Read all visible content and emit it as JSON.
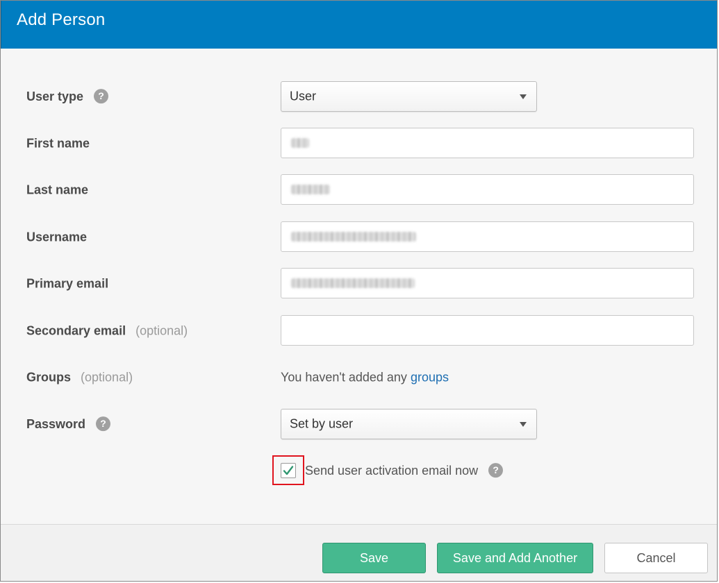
{
  "dialog": {
    "title": "Add Person"
  },
  "form": {
    "user_type": {
      "label": "User type",
      "value": "User",
      "help_icon": "question-circle-icon"
    },
    "first_name": {
      "label": "First name",
      "value_redacted": true
    },
    "last_name": {
      "label": "Last name",
      "value_redacted": true
    },
    "username": {
      "label": "Username",
      "value_redacted": true
    },
    "primary_email": {
      "label": "Primary email",
      "value_redacted": true
    },
    "secondary_email": {
      "label": "Secondary email",
      "optional": "(optional)",
      "value": ""
    },
    "groups": {
      "label": "Groups",
      "optional": "(optional)",
      "text": "You haven't added any",
      "link": "groups"
    },
    "password": {
      "label": "Password",
      "value": "Set by user",
      "help_icon": "question-circle-icon"
    },
    "activation": {
      "label": "Send user activation email now",
      "checked": true,
      "help_icon": "question-circle-icon"
    }
  },
  "footer": {
    "save_label": "Save",
    "save_add_label": "Save and Add Another",
    "cancel_label": "Cancel"
  },
  "colors": {
    "header": "#007dc1",
    "primary_button": "#46b98f",
    "link": "#1f6fb2",
    "checkmark": "#2f9670",
    "highlight": "#e0141e"
  }
}
